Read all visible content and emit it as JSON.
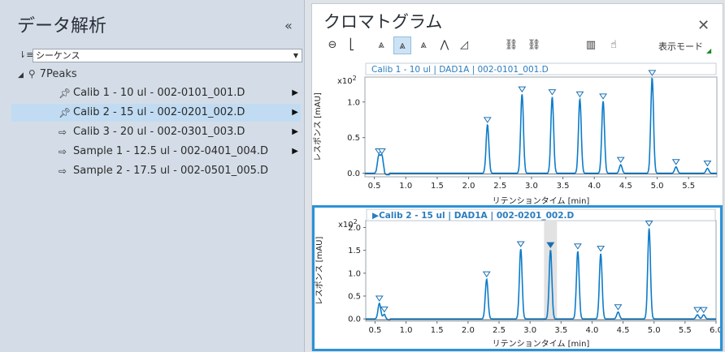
{
  "left_panel": {
    "title": "データ解析",
    "collapse_glyph": "«",
    "sequence_select": "シーケンス",
    "tree_root": "7Peaks",
    "items": [
      {
        "label": "Calib 1 - 10 ul - 002-0101_001.D",
        "icon": "pin-icon",
        "selected": false
      },
      {
        "label": "Calib 2 - 15 ul - 002-0201_002.D",
        "icon": "pin-icon",
        "selected": true
      },
      {
        "label": "Calib 3 - 20 ul - 002-0301_003.D",
        "icon": "pin-outline-icon",
        "selected": false
      },
      {
        "label": "Sample 1 - 12.5 ul - 002-0401_004.D",
        "icon": "pin-outline-icon",
        "selected": false
      },
      {
        "label": "Sample 2 - 17.5 ul - 002-0501_005.D",
        "icon": "pin-outline-icon",
        "selected": false
      }
    ]
  },
  "right_panel": {
    "title": "クロマトグラム",
    "close_glyph": "✕",
    "display_mode": "表示モード",
    "toolbar_icons": [
      "zoom-out-icon",
      "baseline-icon",
      "peaks-filled-icon",
      "peaks-overlay-icon",
      "peaks-stack-icon",
      "peaks-line-icon",
      "peaks-area-icon",
      "link-x-icon",
      "link-y-icon",
      "histogram-icon",
      "hand-pointer-icon"
    ]
  },
  "colors": {
    "trace": "#0d7cc9",
    "marker": "#1a6fb0",
    "frame_selected": "#2b92d8",
    "title_text": "#2a7cbf"
  },
  "chart_data": [
    {
      "type": "line",
      "title": "Calib 1 - 10 ul | DAD1A | 002-0101_001.D",
      "ylabel": "レスポンス [mAU]",
      "xlabel": "リテンションタイム [min]",
      "y_multiplier": "x10 2",
      "x_ticks": [
        "0.5",
        "1.0",
        "1.5",
        "2.0",
        "2.5",
        "3.0",
        "3.5",
        "4.0",
        "4.5",
        "5.0",
        "5.5"
      ],
      "y_ticks": [
        "0.0",
        "0.5",
        "1.0"
      ],
      "xlim": [
        0.35,
        5.95
      ],
      "ylim": [
        -0.05,
        1.35
      ],
      "peaks": [
        {
          "x": 0.57,
          "y": 0.24
        },
        {
          "x": 0.62,
          "y": 0.24
        },
        {
          "x": 2.3,
          "y": 0.68
        },
        {
          "x": 2.85,
          "y": 1.11
        },
        {
          "x": 3.33,
          "y": 1.07
        },
        {
          "x": 3.77,
          "y": 1.04
        },
        {
          "x": 4.14,
          "y": 1.01
        },
        {
          "x": 4.42,
          "y": 0.12
        },
        {
          "x": 4.92,
          "y": 1.34
        },
        {
          "x": 5.3,
          "y": 0.09
        },
        {
          "x": 5.8,
          "y": 0.07
        }
      ]
    },
    {
      "type": "line",
      "title": "▶Calib 2 - 15 ul | DAD1A | 002-0201_002.D",
      "ylabel": "レスポンス [mAU]",
      "xlabel": "リテンションタイム [min]",
      "y_multiplier": "x10 2",
      "x_ticks": [
        "0.5",
        "1.0",
        "1.5",
        "2.0",
        "2.5",
        "3.0",
        "3.5",
        "4.0",
        "4.5",
        "5.0",
        "5.5",
        "6.0"
      ],
      "y_ticks": [
        "0.0",
        "0.5",
        "1.0",
        "1.5",
        "2.0"
      ],
      "xlim": [
        0.35,
        6.0
      ],
      "ylim": [
        -0.05,
        2.15
      ],
      "highlight_x": 3.33,
      "peaks": [
        {
          "x": 0.57,
          "y": 0.34
        },
        {
          "x": 0.65,
          "y": 0.1
        },
        {
          "x": 2.3,
          "y": 0.87
        },
        {
          "x": 2.85,
          "y": 1.53
        },
        {
          "x": 3.33,
          "y": 1.51
        },
        {
          "x": 3.77,
          "y": 1.48
        },
        {
          "x": 4.14,
          "y": 1.43
        },
        {
          "x": 4.42,
          "y": 0.15
        },
        {
          "x": 4.92,
          "y": 1.98
        },
        {
          "x": 5.7,
          "y": 0.09
        },
        {
          "x": 5.8,
          "y": 0.09
        }
      ]
    }
  ]
}
